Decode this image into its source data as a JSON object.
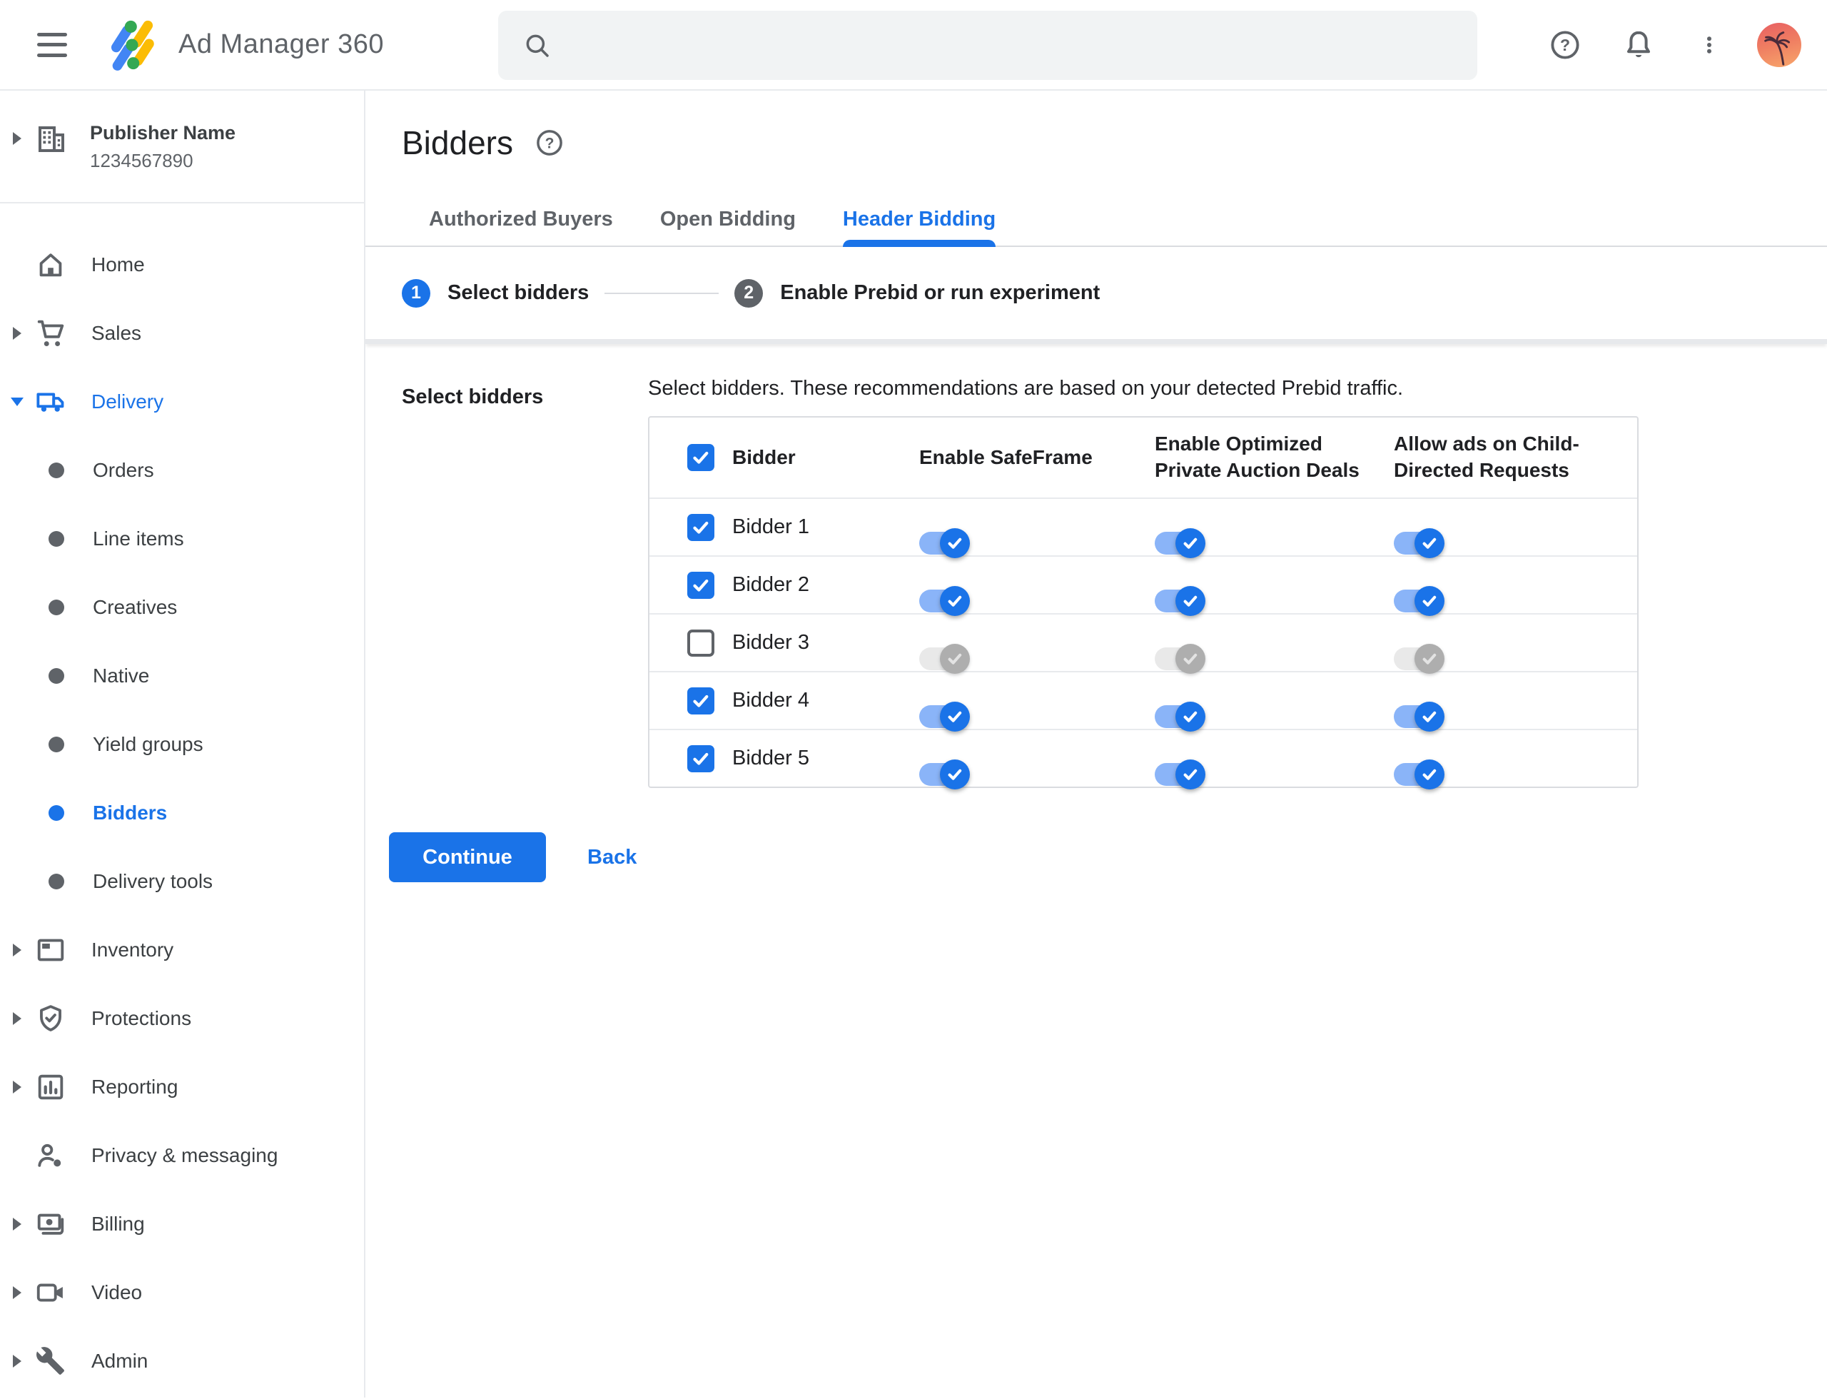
{
  "header": {
    "app_name": "Ad Manager 360",
    "search": {
      "placeholder": "",
      "value": ""
    }
  },
  "sidebar": {
    "account": {
      "name": "Publisher Name",
      "id": "1234567890",
      "icon": "building-icon",
      "caret": "right"
    },
    "items": [
      {
        "label": "Home",
        "icon": "home-icon",
        "caret": "none"
      },
      {
        "label": "Sales",
        "icon": "cart-icon",
        "caret": "right"
      },
      {
        "label": "Delivery",
        "icon": "truck-icon",
        "caret": "down",
        "expanded": true,
        "accent": true
      },
      {
        "label": "Orders",
        "type": "sub"
      },
      {
        "label": "Line items",
        "type": "sub"
      },
      {
        "label": "Creatives",
        "type": "sub"
      },
      {
        "label": "Native",
        "type": "sub"
      },
      {
        "label": "Yield groups",
        "type": "sub"
      },
      {
        "label": "Bidders",
        "type": "sub",
        "selected": true
      },
      {
        "label": "Delivery tools",
        "type": "sub"
      },
      {
        "label": "Inventory",
        "icon": "inventory-icon",
        "caret": "right"
      },
      {
        "label": "Protections",
        "icon": "shield-check-icon",
        "caret": "right"
      },
      {
        "label": "Reporting",
        "icon": "bar-chart-icon",
        "caret": "right"
      },
      {
        "label": "Privacy & messaging",
        "icon": "person-privacy-icon",
        "caret": "none"
      },
      {
        "label": "Billing",
        "icon": "money-icon",
        "caret": "right"
      },
      {
        "label": "Video",
        "icon": "video-camera-icon",
        "caret": "right"
      },
      {
        "label": "Admin",
        "icon": "wrench-icon",
        "caret": "right"
      }
    ]
  },
  "page": {
    "title": "Bidders",
    "help_icon": "help-icon"
  },
  "tabs": [
    {
      "label": "Authorized Buyers",
      "active": false
    },
    {
      "label": "Open Bidding",
      "active": false
    },
    {
      "label": "Header Bidding",
      "active": true
    }
  ],
  "stepper": [
    {
      "number": "1",
      "label": "Select bidders",
      "state": "active"
    },
    {
      "number": "2",
      "label": "Enable Prebid or run experiment",
      "state": "upcoming"
    }
  ],
  "section": {
    "label": "Select bidders",
    "description": "Select bidders. These recommendations are based on your detected Prebid traffic."
  },
  "table": {
    "header_checkbox_checked": true,
    "columns": [
      "Bidder",
      "Enable SafeFrame",
      "Enable Optimized Private Auction Deals",
      "Allow ads on Child-Directed Requests"
    ],
    "toggle_keys": [
      "enable_safeframe",
      "optimized_private_auction_deals",
      "allow_child_directed"
    ],
    "rows": [
      {
        "name": "Bidder 1",
        "checked": true,
        "enable_safeframe": "on",
        "optimized_private_auction_deals": "on",
        "allow_child_directed": "on"
      },
      {
        "name": "Bidder 2",
        "checked": true,
        "enable_safeframe": "on",
        "optimized_private_auction_deals": "on",
        "allow_child_directed": "on"
      },
      {
        "name": "Bidder 3",
        "checked": false,
        "enable_safeframe": "disabled",
        "optimized_private_auction_deals": "disabled",
        "allow_child_directed": "disabled"
      },
      {
        "name": "Bidder 4",
        "checked": true,
        "enable_safeframe": "on",
        "optimized_private_auction_deals": "on",
        "allow_child_directed": "on"
      },
      {
        "name": "Bidder 5",
        "checked": true,
        "enable_safeframe": "on",
        "optimized_private_auction_deals": "on",
        "allow_child_directed": "on"
      }
    ]
  },
  "actions": {
    "continue_label": "Continue",
    "back_label": "Back"
  },
  "colors": {
    "accent": "#1a73e8",
    "toggle_track_on": "#8ab4f8",
    "selected_nav_bg": "#e8f0fe",
    "text_primary": "#202124",
    "text_secondary": "#5f6368",
    "border": "#dadce0",
    "row_divider": "#e8eaed",
    "search_bg": "#f1f3f4",
    "disabled_track": "#e9e9e9",
    "disabled_thumb": "#aeaeae",
    "step_upcoming": "#5f6368"
  }
}
